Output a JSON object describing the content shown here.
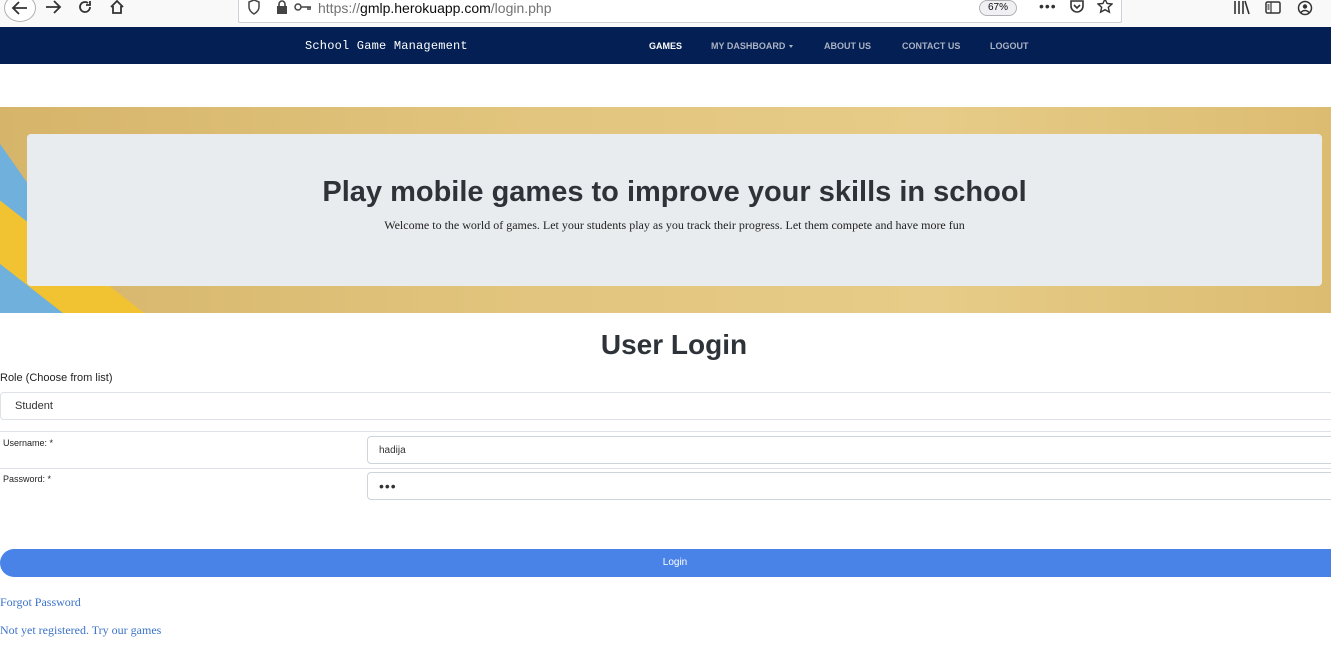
{
  "browser": {
    "url_prefix": "https://",
    "url_host": "gmlp.herokuapp.com",
    "url_path": "/login.php",
    "zoom": "67%",
    "more": "•••"
  },
  "navbar": {
    "brand": "School Game Management",
    "items": [
      {
        "label": "GAMES"
      },
      {
        "label": "MY DASHBOARD"
      },
      {
        "label": "ABOUT US"
      },
      {
        "label": "CONTACT US"
      },
      {
        "label": "LOGOUT"
      }
    ]
  },
  "hero": {
    "title": "Play mobile games to improve your skills in school",
    "subtitle": "Welcome to the world of games. Let your students play as you track their progress. Let them compete and have more fun"
  },
  "login": {
    "title": "User Login",
    "role_label": "Role (Choose from list)",
    "role_value": "Student",
    "username_label": "Username: *",
    "username_value": "hadija",
    "password_label": "Password: *",
    "password_value": "•••",
    "submit_label": "Login",
    "forgot_label": "Forgot Password",
    "register_label": "Not yet registered. Try our games"
  },
  "colors": {
    "navbar_bg": "#031f53",
    "button_bg": "#4a83e8",
    "link": "#3b73c9",
    "jumbotron_bg": "#e9ecef"
  }
}
